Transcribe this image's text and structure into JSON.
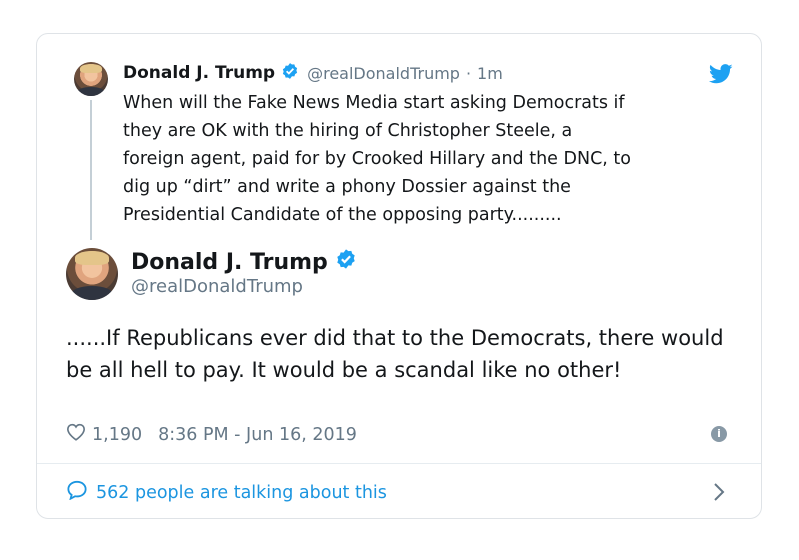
{
  "quoted_tweet": {
    "author_name": "Donald J. Trump",
    "handle": "@realDonaldTrump",
    "separator": "·",
    "time_ago": "1m",
    "text": "When will the Fake News Media start asking Democrats if\nthey are OK with the hiring of Christopher Steele, a\nforeign agent, paid for by Crooked Hillary and the DNC, to\ndig up “dirt” and write a phony Dossier against the\nPresidential Candidate of the opposing party........."
  },
  "main_tweet": {
    "author_name": "Donald J. Trump",
    "handle": "@realDonaldTrump",
    "text": "......If Republicans ever did that to the Democrats, there would be all hell to pay. It would be a scandal like no other!",
    "like_count": "1,190",
    "timestamp": "8:36 PM - Jun 16, 2019"
  },
  "conversation": {
    "label": "562 people are talking about this"
  },
  "colors": {
    "twitter_blue": "#1da1f2",
    "link_blue": "#1b95e0",
    "muted_gray": "#657786",
    "text_dark": "#14171a",
    "border": "#dfe3e7"
  },
  "icons": [
    "verified-badge-icon",
    "twitter-bird-icon",
    "heart-icon",
    "info-icon",
    "comment-bubble-icon",
    "chevron-right-icon"
  ]
}
